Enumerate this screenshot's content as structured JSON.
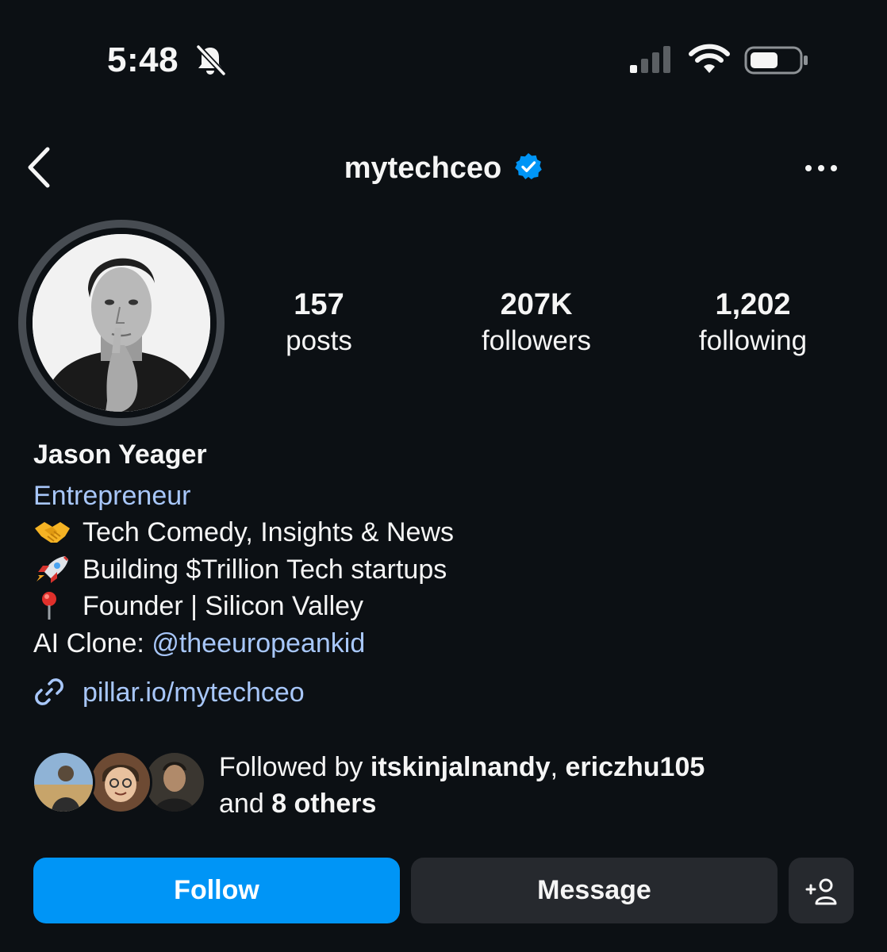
{
  "status_bar": {
    "time": "5:48",
    "icons": [
      "bell-slash-icon",
      "signal-icon",
      "wifi-icon",
      "battery-icon"
    ]
  },
  "nav": {
    "username": "mytechceo",
    "icons": [
      "back-chevron-icon",
      "verified-badge-icon",
      "more-options-icon"
    ]
  },
  "profile": {
    "stats": [
      {
        "value": "157",
        "label": "posts"
      },
      {
        "value": "207K",
        "label": "followers"
      },
      {
        "value": "1,202",
        "label": "following"
      }
    ],
    "name": "Jason Yeager",
    "category": "Entrepreneur",
    "bio": [
      {
        "emoji": "handshake-icon",
        "text": "Tech Comedy, Insights & News"
      },
      {
        "emoji": "rocket-icon",
        "text": "Building $Trillion Tech startups"
      },
      {
        "emoji": "round-pushpin-icon",
        "text": "Founder | Silicon Valley"
      }
    ],
    "ai_clone_label": "AI Clone: ",
    "ai_clone_handle": "@theeuropeankid",
    "link": "pillar.io/mytechceo"
  },
  "followed_by": {
    "prefix": "Followed by ",
    "users": [
      "itskinjalnandy",
      "ericzhu105"
    ],
    "separator": ", ",
    "and_text": "and ",
    "others": "8 others"
  },
  "actions": {
    "follow": "Follow",
    "message": "Message",
    "add_icon": "add-person-icon"
  },
  "colors": {
    "background": "#0c1014",
    "accent_blue": "#0095f6",
    "link_blue": "#a8c7fa",
    "button_gray": "#26292e"
  }
}
